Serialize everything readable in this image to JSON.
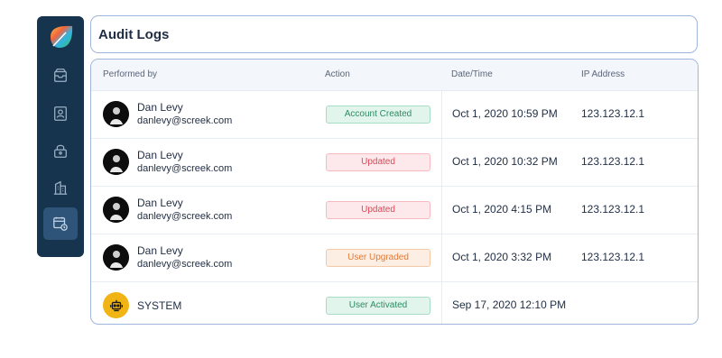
{
  "page": {
    "title": "Audit Logs"
  },
  "sidebar": {
    "items": [
      {
        "icon": "inbox-icon",
        "active": false
      },
      {
        "icon": "contact-card-icon",
        "active": false
      },
      {
        "icon": "lock-icon",
        "active": false
      },
      {
        "icon": "building-icon",
        "active": false
      },
      {
        "icon": "calendar-clock-icon",
        "active": true
      }
    ]
  },
  "table": {
    "headers": {
      "performed_by": "Performed by",
      "action": "Action",
      "datetime": "Date/Time",
      "ip": "IP Address"
    },
    "rows": [
      {
        "name": "Dan Levy",
        "email": "danlevy@screek.com",
        "action": "Account Created",
        "status": "green",
        "datetime": "Oct 1, 2020 10:59 PM",
        "ip": "123.123.12.1"
      },
      {
        "name": "Dan Levy",
        "email": "danlevy@screek.com",
        "action": "Updated",
        "status": "red",
        "datetime": "Oct 1, 2020 10:32 PM",
        "ip": "123.123.12.1"
      },
      {
        "name": "Dan Levy",
        "email": "danlevy@screek.com",
        "action": "Updated",
        "status": "red",
        "datetime": "Oct 1, 2020 4:15 PM",
        "ip": "123.123.12.1"
      },
      {
        "name": "Dan Levy",
        "email": "danlevy@screek.com",
        "action": "User Upgraded",
        "status": "orange",
        "datetime": "Oct 1, 2020 3:32 PM",
        "ip": "123.123.12.1"
      },
      {
        "name": "SYSTEM",
        "email": "",
        "action": "User Activated",
        "status": "green",
        "datetime": "Sep 17, 2020 12:10 PM",
        "ip": ""
      }
    ]
  },
  "colors": {
    "sidebar_bg": "#17344f",
    "sidebar_active": "#2f5479",
    "border": "#9fb6dc"
  }
}
